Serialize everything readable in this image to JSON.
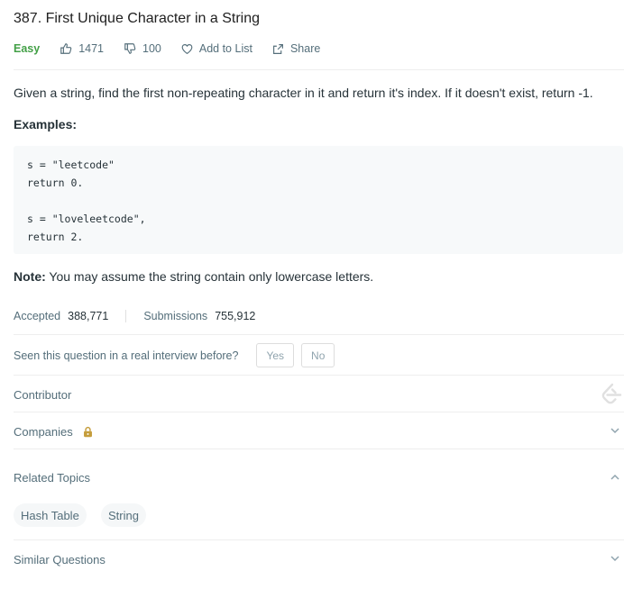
{
  "problem": {
    "title": "387. First Unique Character in a String",
    "difficulty": "Easy",
    "likes": "1471",
    "dislikes": "100",
    "add_to_list": "Add to List",
    "share": "Share"
  },
  "content": {
    "description": "Given a string, find the first non-repeating character in it and return it's index. If it doesn't exist, return -1.",
    "examples_heading": "Examples:",
    "code_lines": [
      "s = \"leetcode\"",
      "return 0.",
      "",
      "s = \"loveleetcode\",",
      "return 2."
    ],
    "note_label": "Note:",
    "note_text": " You may assume the string contain only lowercase letters."
  },
  "stats": {
    "accepted_label": "Accepted",
    "accepted_value": "388,771",
    "submissions_label": "Submissions",
    "submissions_value": "755,912"
  },
  "interview": {
    "question": "Seen this question in a real interview before?",
    "yes": "Yes",
    "no": "No"
  },
  "sections": {
    "contributor": "Contributor",
    "companies": "Companies",
    "related_topics": "Related Topics",
    "similar_questions": "Similar Questions"
  },
  "topics": [
    "Hash Table",
    "String"
  ],
  "colors": {
    "easy": "#43a047",
    "text": "#263238",
    "muted": "#546e7a",
    "lock": "#c59d3c"
  },
  "icons": [
    "thumbs-up-icon",
    "thumbs-down-icon",
    "heart-icon",
    "share-icon",
    "leetcode-logo-icon",
    "lock-icon",
    "chevron-down-icon",
    "chevron-up-icon"
  ]
}
